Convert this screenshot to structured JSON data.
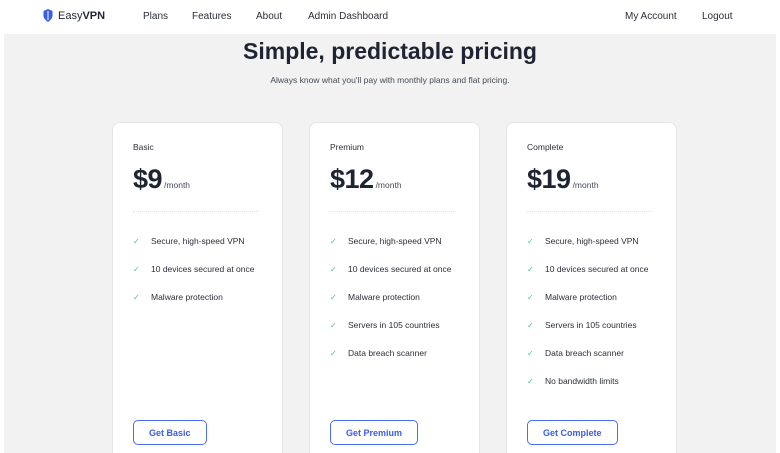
{
  "nav": {
    "brand_prefix": "Easy",
    "brand_suffix": "VPN",
    "links": [
      "Plans",
      "Features",
      "About",
      "Admin Dashboard"
    ],
    "account": "My Account",
    "logout": "Logout"
  },
  "hero": {
    "title": "Simple, predictable pricing",
    "subtitle": "Always know what you'll pay with monthly plans and flat pricing."
  },
  "plans": [
    {
      "name": "Basic",
      "price": "$9",
      "period": "/month",
      "features": [
        "Secure, high-speed VPN",
        "10 devices secured at once",
        "Malware protection"
      ],
      "cta": "Get Basic"
    },
    {
      "name": "Premium",
      "price": "$12",
      "period": "/month",
      "features": [
        "Secure, high-speed VPN",
        "10 devices secured at once",
        "Malware protection",
        "Servers in 105 countries",
        "Data breach scanner"
      ],
      "cta": "Get Premium"
    },
    {
      "name": "Complete",
      "price": "$19",
      "period": "/month",
      "features": [
        "Secure, high-speed VPN",
        "10 devices secured at once",
        "Malware protection",
        "Servers in 105 countries",
        "Data breach scanner",
        "No bandwidth limits"
      ],
      "cta": "Get Complete"
    }
  ],
  "icons": {
    "brand": "shield-logo-icon",
    "feature": "check-icon"
  },
  "colors": {
    "accent": "#3b5cf0",
    "check": "#4fb8a4",
    "background": "#f2f2f2"
  }
}
